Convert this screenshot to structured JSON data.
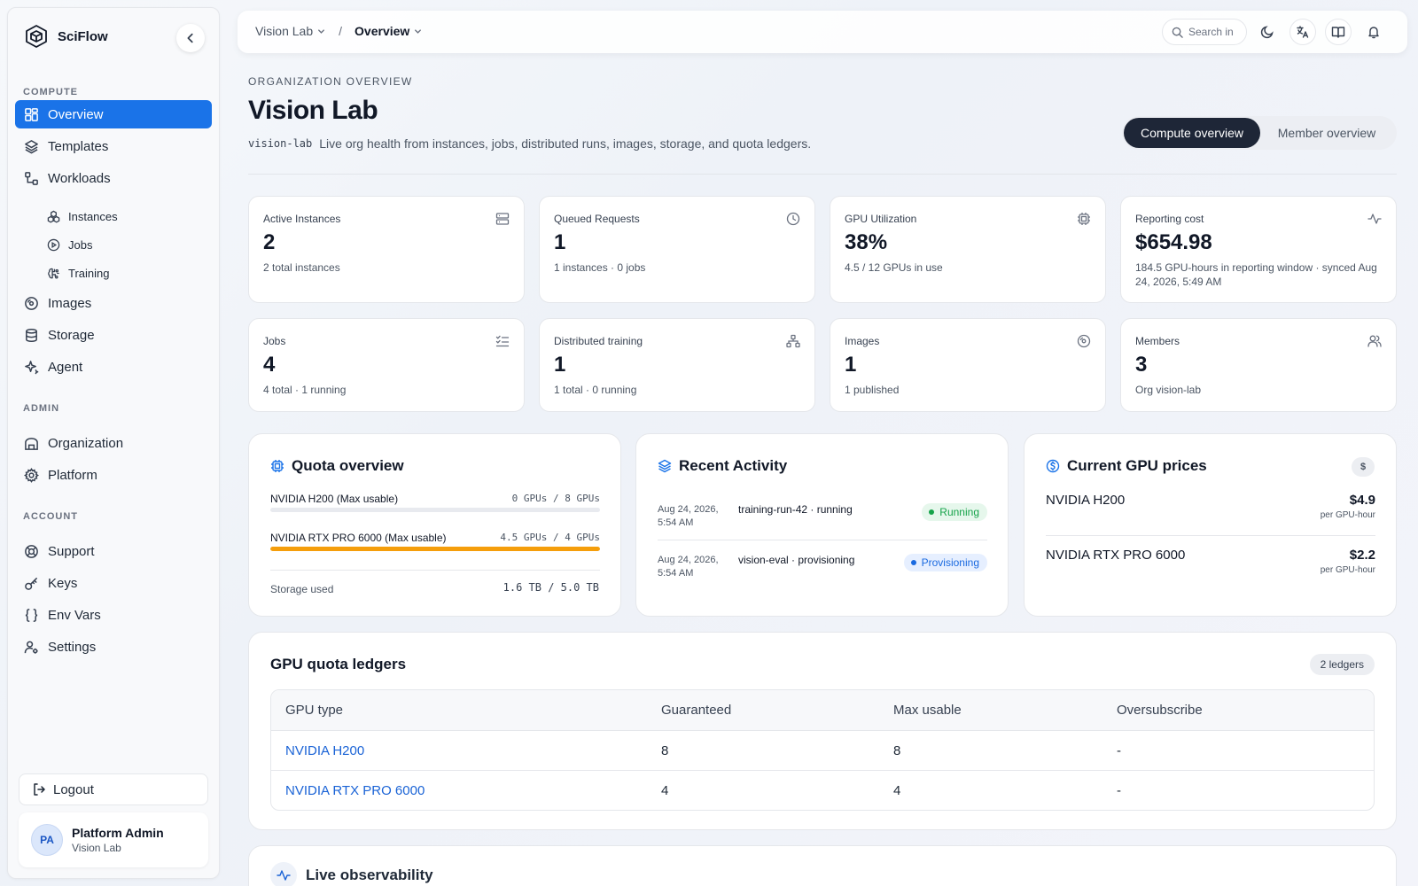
{
  "brand": {
    "name": "SciFlow"
  },
  "sidebar": {
    "sections": {
      "compute": "COMPUTE",
      "admin": "ADMIN",
      "account": "ACCOUNT"
    },
    "items": {
      "overview": "Overview",
      "templates": "Templates",
      "workloads": "Workloads",
      "instances": "Instances",
      "jobs": "Jobs",
      "training": "Training",
      "images": "Images",
      "storage": "Storage",
      "agent": "Agent",
      "organization": "Organization",
      "platform": "Platform",
      "support": "Support",
      "keys": "Keys",
      "env_vars": "Env Vars",
      "settings": "Settings"
    },
    "logout": "Logout",
    "user": {
      "initials": "PA",
      "name": "Platform Admin",
      "org": "Vision Lab"
    }
  },
  "topbar": {
    "breadcrumb": {
      "org": "Vision Lab",
      "separator": "/",
      "page": "Overview"
    },
    "search_placeholder": "Search in"
  },
  "header": {
    "eyebrow": "ORGANIZATION OVERVIEW",
    "title": "Vision Lab",
    "slug": "vision-lab",
    "subtitle": "Live org health from instances, jobs, distributed runs, images, storage, and quota ledgers.",
    "toggle": {
      "active": "Compute overview",
      "inactive": "Member overview"
    }
  },
  "stats": [
    {
      "label": "Active Instances",
      "value": "2",
      "meta": "2 total instances",
      "icon": "server-icon"
    },
    {
      "label": "Queued Requests",
      "value": "1",
      "meta": "1 instances · 0 jobs",
      "icon": "clock-icon"
    },
    {
      "label": "GPU Utilization",
      "value": "38%",
      "meta": "4.5 / 12 GPUs in use",
      "icon": "cpu-icon"
    },
    {
      "label": "Reporting cost",
      "value": "$654.98",
      "meta": "184.5 GPU-hours in reporting window · synced Aug 24, 2026, 5:49 AM",
      "icon": "activity-icon"
    },
    {
      "label": "Jobs",
      "value": "4",
      "meta": "4 total · 1 running",
      "icon": "list-checks-icon"
    },
    {
      "label": "Distributed training",
      "value": "1",
      "meta": "1 total · 0 running",
      "icon": "network-icon"
    },
    {
      "label": "Images",
      "value": "1",
      "meta": "1 published",
      "icon": "disc-icon"
    },
    {
      "label": "Members",
      "value": "3",
      "meta": "Org vision-lab",
      "icon": "users-icon"
    }
  ],
  "quota": {
    "title": "Quota overview",
    "rows": [
      {
        "name": "NVIDIA H200 (Max usable)",
        "value": "0 GPUs / 8 GPUs",
        "fraction": 0
      },
      {
        "name": "NVIDIA RTX PRO 6000 (Max usable)",
        "value": "4.5 GPUs / 4 GPUs",
        "fraction": 1
      }
    ],
    "storage_label": "Storage used",
    "storage_value": "1.6 TB / 5.0 TB",
    "bar_color": "#f59e0b"
  },
  "activity": {
    "title": "Recent Activity",
    "rows": [
      {
        "time": "Aug 24, 2026, 5:54 AM",
        "text": "training-run-42 · running",
        "status": "Running"
      },
      {
        "time": "Aug 24, 2026, 5:54 AM",
        "text": "vision-eval · provisioning",
        "status": "Provisioning"
      }
    ]
  },
  "prices": {
    "title": "Current GPU prices",
    "badge": "$",
    "rows": [
      {
        "name": "NVIDIA H200",
        "price": "$4.9",
        "unit": "per GPU-hour"
      },
      {
        "name": "NVIDIA RTX PRO 6000",
        "price": "$2.2",
        "unit": "per GPU-hour"
      }
    ]
  },
  "ledgers": {
    "title": "GPU quota ledgers",
    "count": "2 ledgers",
    "columns": [
      "GPU type",
      "Guaranteed",
      "Max usable",
      "Oversubscribe"
    ],
    "rows": [
      [
        "NVIDIA H200",
        "8",
        "8",
        "-"
      ],
      [
        "NVIDIA RTX PRO 6000",
        "4",
        "4",
        "-"
      ]
    ]
  },
  "observability": {
    "title": "Live observability"
  },
  "colors": {
    "accent": "#1a73e8",
    "dark": "#1e2637",
    "warning": "#f59e0b",
    "success": "#16a34a"
  }
}
